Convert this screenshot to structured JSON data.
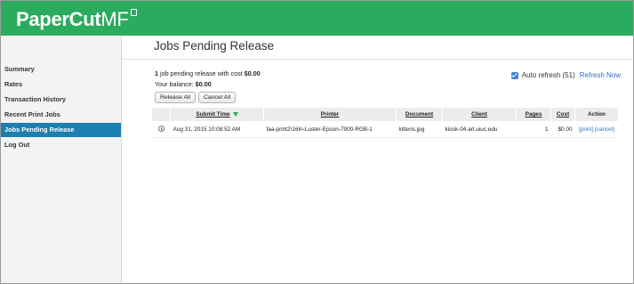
{
  "brand": {
    "name_bold": "PaperCut",
    "name_light": "MF"
  },
  "nav": [
    {
      "label": "Summary",
      "active": false
    },
    {
      "label": "Rates",
      "active": false
    },
    {
      "label": "Transaction History",
      "active": false
    },
    {
      "label": "Recent Print Jobs",
      "active": false
    },
    {
      "label": "Jobs Pending Release",
      "active": true
    },
    {
      "label": "Log Out",
      "active": false
    }
  ],
  "page": {
    "title": "Jobs Pending Release",
    "summary_prefix": "1",
    "summary_middle": " job pending release with cost ",
    "summary_cost": "$0.00",
    "balance_label": "Your balance: ",
    "balance_value": "$0.00",
    "release_all": "Release All",
    "cancel_all": "Cancel All",
    "auto_refresh": "Auto refresh (51)",
    "refresh_now": "Refresh Now"
  },
  "table": {
    "headers": {
      "submit_time": "Submit Time",
      "printer": "Printer",
      "document": "Document",
      "client": "Client",
      "pages": "Pages",
      "cost": "Cost",
      "action": "Action"
    },
    "rows": [
      {
        "submit_time": "Aug 31, 2015 10:08:52 AM",
        "printer": "faa-print2\\16In-Luster-Epson-7900-RGB-1",
        "document": "kittens.jpg",
        "client": "kiosk-04.art.uiuc.edu",
        "pages": "1",
        "cost": "$0.00",
        "print": "[print]",
        "cancel": "[cancel]"
      }
    ]
  },
  "colors": {
    "header_green": "#2bab5e",
    "active_nav": "#1b7fb0",
    "link": "#2a72c3"
  },
  "icons": {
    "row_status": "clock-icon",
    "sort": "sort-down-arrow-icon"
  }
}
